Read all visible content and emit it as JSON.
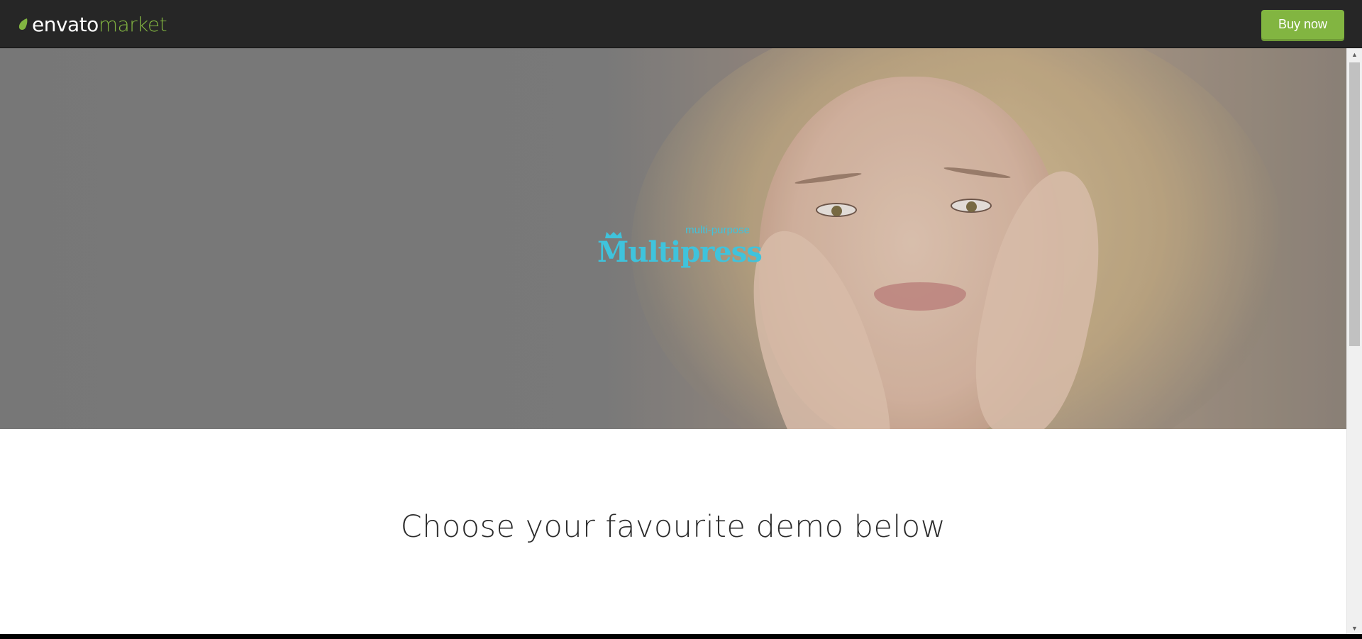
{
  "topbar": {
    "brand_envato": "envato",
    "brand_market": "market",
    "buy_label": "Buy now",
    "accent": "#82b541",
    "background": "#262626"
  },
  "hero": {
    "logo_sub": "multi-purpose",
    "logo_main": "Multipress",
    "logo_color": "#3fc3dc"
  },
  "main": {
    "headline": "Choose your favourite demo below"
  },
  "icons": {
    "leaf": "envato-leaf-icon",
    "crown": "crown-icon",
    "scroll_up": "scroll-up-arrow-icon",
    "scroll_down": "scroll-down-arrow-icon"
  }
}
